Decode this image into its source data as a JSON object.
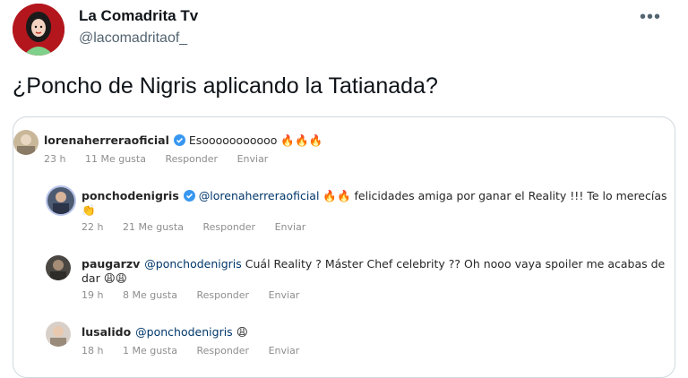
{
  "tweet": {
    "author_name": "La Comadrita Tv",
    "author_handle": "@lacomadritaof_",
    "more_icon": "more-icon",
    "text": "¿Poncho de Nigris aplicando la Tatianada?"
  },
  "comments": [
    {
      "username": "lorenaherreraoficial",
      "verified": true,
      "text": "Esooooooooooo 🔥🔥🔥",
      "time": "23 h",
      "likes": "11 Me gusta",
      "reply": "Responder",
      "send": "Enviar"
    },
    {
      "username": "ponchodenigris",
      "verified": true,
      "mention": "@lorenaherreraoficial",
      "text": "🔥🔥 felicidades amiga por ganar el Reality !!! Te lo merecías",
      "text_line2": "👏",
      "time": "22 h",
      "likes": "21 Me gusta",
      "reply": "Responder",
      "send": "Enviar"
    },
    {
      "username": "paugarzv",
      "mention": "@ponchodenigris",
      "text": "Cuál Reality ? Máster Chef celebrity ?? Oh nooo vaya spoiler me acabas de",
      "text_line2": "dar 😩😩",
      "time": "19 h",
      "likes": "8 Me gusta",
      "reply": "Responder",
      "send": "Enviar"
    },
    {
      "username": "lusalido",
      "mention": "@ponchodenigris",
      "text": "😩",
      "time": "18 h",
      "likes": "1 Me gusta",
      "reply": "Responder",
      "send": "Enviar"
    }
  ]
}
